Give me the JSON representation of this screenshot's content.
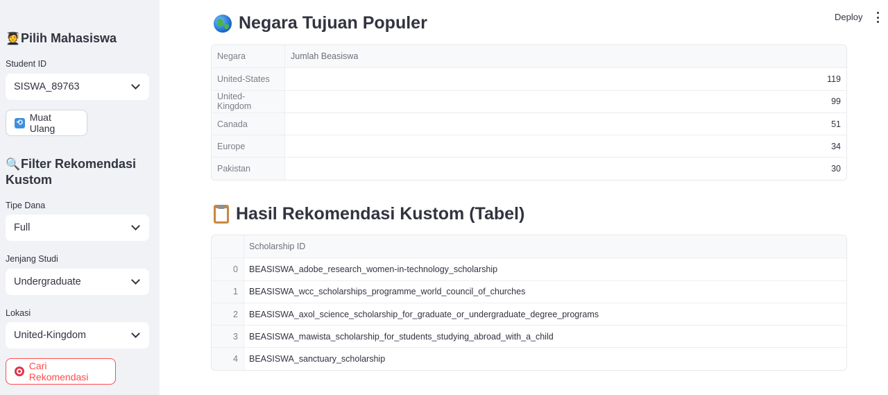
{
  "sidebar": {
    "student_section": {
      "title": "Pilih Mahasiswa",
      "icon": "student-icon"
    },
    "student_id": {
      "label": "Student ID",
      "value": "SISWA_89763"
    },
    "reload_button": {
      "label": "Muat Ulang",
      "icon": "reload-icon"
    },
    "filter_section": {
      "title": "Filter Rekomendasi Kustom",
      "icon": "magnifier-icon"
    },
    "tipe_dana": {
      "label": "Tipe Dana",
      "value": "Full"
    },
    "jenjang_studi": {
      "label": "Jenjang Studi",
      "value": "Undergraduate"
    },
    "lokasi": {
      "label": "Lokasi",
      "value": "United-Kingdom"
    },
    "search_button": {
      "label": "Cari Rekomendasi",
      "icon": "target-icon",
      "color": "#ff4b4b"
    }
  },
  "header": {
    "deploy_label": "Deploy"
  },
  "popular_countries": {
    "title": "Negara Tujuan Populer",
    "icon": "globe-icon",
    "columns": [
      "Negara",
      "Jumlah Beasiswa"
    ],
    "rows": [
      {
        "country": "United-States",
        "count": "119"
      },
      {
        "country": "United-Kingdom",
        "count": "99"
      },
      {
        "country": "Canada",
        "count": "51"
      },
      {
        "country": "Europe",
        "count": "34"
      },
      {
        "country": "Pakistan",
        "count": "30"
      }
    ]
  },
  "custom_results": {
    "title": "Hasil Rekomendasi Kustom (Tabel)",
    "icon": "clipboard-icon",
    "columns": [
      "",
      "Scholarship ID"
    ],
    "rows": [
      {
        "index": "0",
        "id": "BEASISWA_adobe_research_women-in-technology_scholarship"
      },
      {
        "index": "1",
        "id": "BEASISWA_wcc_scholarships_programme_world_council_of_churches"
      },
      {
        "index": "2",
        "id": "BEASISWA_axol_science_scholarship_for_graduate_or_undergraduate_degree_programs"
      },
      {
        "index": "3",
        "id": "BEASISWA_mawista_scholarship_for_students_studying_abroad_with_a_child"
      },
      {
        "index": "4",
        "id": "BEASISWA_sanctuary_scholarship"
      }
    ]
  }
}
